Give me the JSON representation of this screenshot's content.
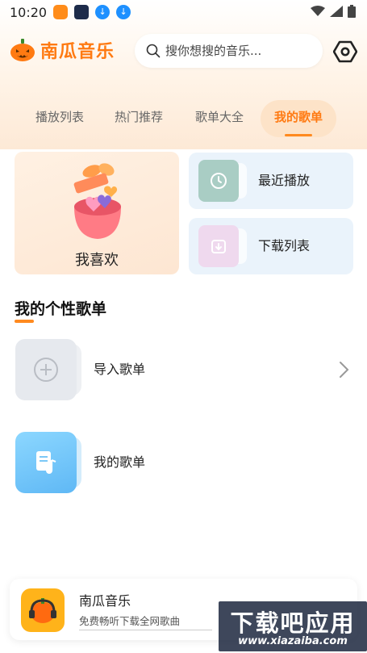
{
  "status_bar": {
    "time": "10:20"
  },
  "header": {
    "app_name": "南瓜音乐",
    "search_placeholder": "搜你想搜的音乐...",
    "brand_color": "#ff7a12"
  },
  "tabs": [
    {
      "label": "播放列表",
      "active": false
    },
    {
      "label": "热门推荐",
      "active": false
    },
    {
      "label": "歌单大全",
      "active": false
    },
    {
      "label": "我的歌单",
      "active": true
    }
  ],
  "cards": {
    "favorite": {
      "label": "我喜欢",
      "icon": "gift-box-hearts-icon"
    },
    "recent": {
      "label": "最近播放",
      "icon": "clock-icon"
    },
    "downloads": {
      "label": "下载列表",
      "icon": "download-box-icon"
    }
  },
  "section": {
    "title": "我的个性歌单",
    "items": [
      {
        "label": "导入歌单",
        "icon": "plus-circle-icon"
      },
      {
        "label": "我的歌单",
        "icon": "music-document-icon"
      }
    ]
  },
  "banner": {
    "title": "南瓜音乐",
    "subtitle": "免费畅听下载全网歌曲"
  },
  "watermark": {
    "title": "下载吧应用",
    "url": "www.xiazaiba.com"
  }
}
